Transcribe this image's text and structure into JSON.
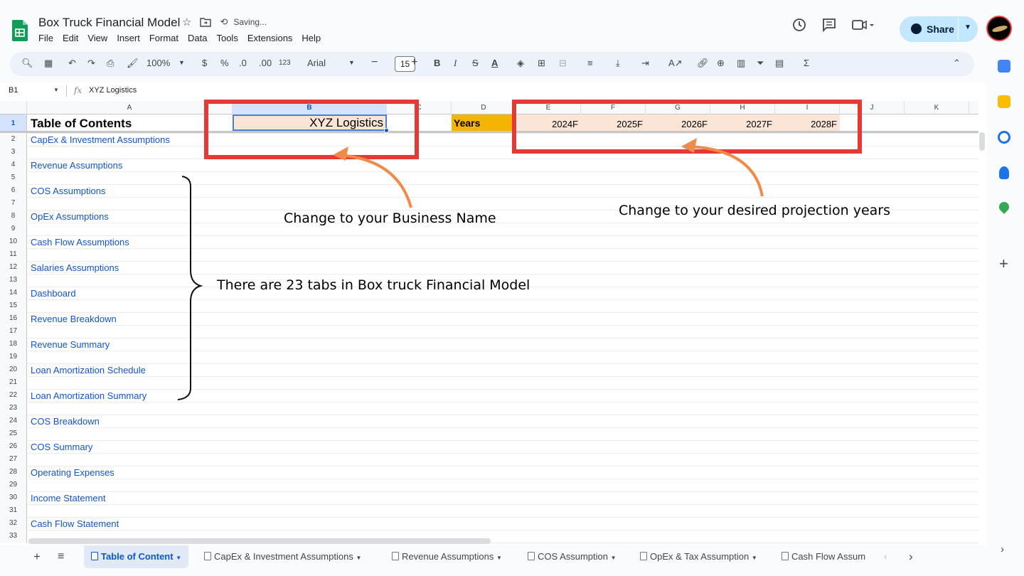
{
  "app": {
    "doc_title": "Box Truck Financial Model",
    "saving_status": "Saving...",
    "menu": [
      "File",
      "Edit",
      "View",
      "Insert",
      "Format",
      "Data",
      "Tools",
      "Extensions",
      "Help"
    ],
    "share_label": "Share",
    "accent_color": "#c2e7ff",
    "brand_color": "#0f9d58"
  },
  "toolbar": {
    "zoom": "100%",
    "currency": "$",
    "percent": "%",
    "dec_decrease": ".0",
    "dec_increase": ".00",
    "format_more": "123",
    "font": "Arial",
    "font_size": "15",
    "bold": "B",
    "italic": "I",
    "sum": "Σ"
  },
  "formula_bar": {
    "cell_ref": "B1",
    "fx": "fx",
    "value": "XYZ Logistics"
  },
  "grid": {
    "columns": [
      "A",
      "B",
      "C",
      "D",
      "E",
      "F",
      "G",
      "H",
      "I",
      "J",
      "K"
    ],
    "selected_column": "B",
    "rows": [
      "1",
      "2",
      "3",
      "4",
      "5",
      "6",
      "7",
      "8",
      "9",
      "10",
      "11",
      "12",
      "13",
      "14",
      "15",
      "16",
      "17",
      "18",
      "19",
      "20",
      "21",
      "22",
      "23",
      "24",
      "25",
      "26",
      "27",
      "28",
      "29",
      "30",
      "31",
      "32",
      "33"
    ],
    "toc_title": "Table of Contents",
    "business_name": "XYZ Logistics",
    "years_label": "Years",
    "years": [
      "2024F",
      "2025F",
      "2026F",
      "2027F",
      "2028F"
    ],
    "toc_links": [
      "CapEx & Investment Assumptions",
      "Revenue Assumptions",
      "COS Assumptions",
      "OpEx Assumptions",
      "Cash Flow Assumptions",
      "Salaries Assumptions",
      "Dashboard",
      "Revenue Breakdown",
      "Revenue Summary",
      "Loan Amortization Schedule",
      "Loan Amortization Summary",
      "COS Breakdown",
      "COS Summary",
      "Operating Expenses",
      "Income Statement",
      "Cash Flow Statement"
    ]
  },
  "annotations": {
    "business_name": "Change to your Business Name",
    "projection_years": "Change to your desired projection years",
    "tabs_count": "There are 23 tabs in Box truck Financial Model",
    "highlight_color": "#e53935",
    "arrow_color": "#f08a4b"
  },
  "tabs": [
    "Table of Content",
    "CapEx & Investment Assumptions",
    "Revenue Assumptions",
    "COS Assumption",
    "OpEx & Tax Assumption",
    "Cash Flow Assum"
  ]
}
